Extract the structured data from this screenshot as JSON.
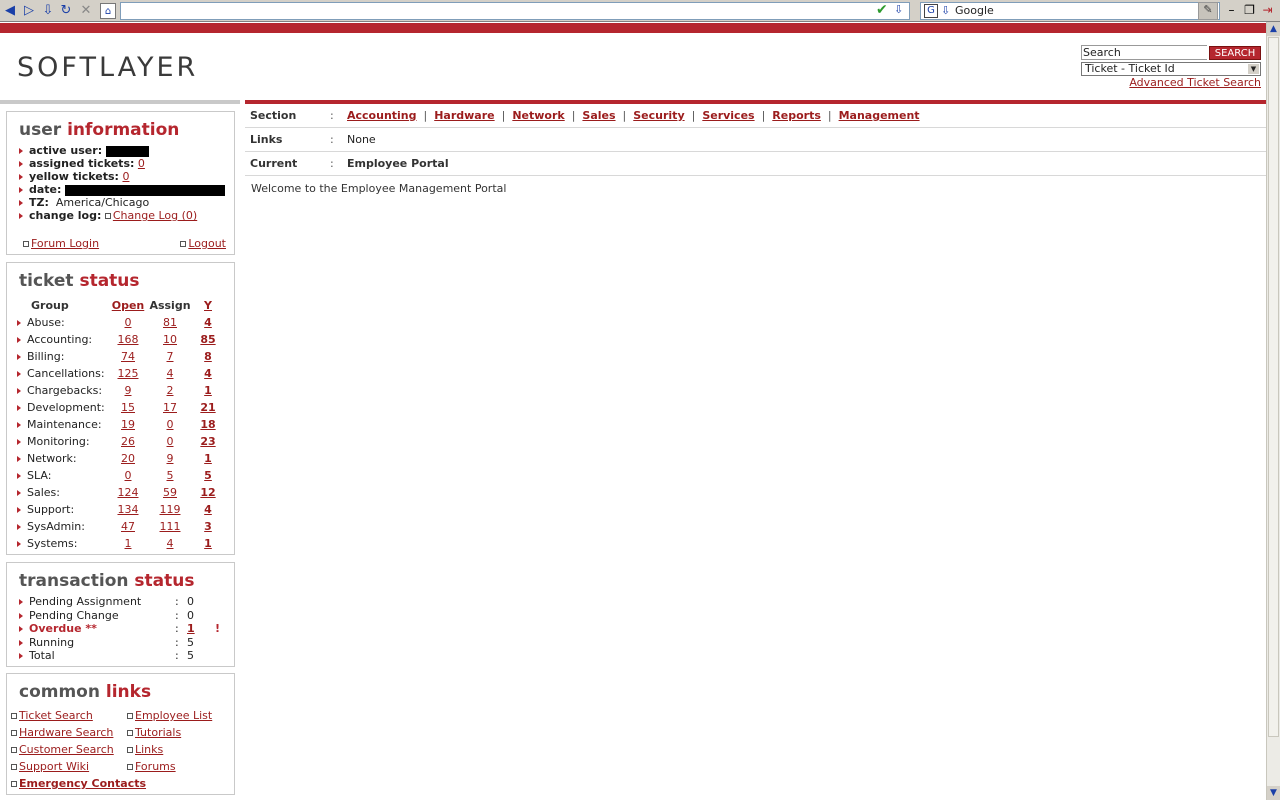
{
  "browser": {
    "search_engine": "Google",
    "buttons": [
      "back-icon",
      "forward-icon",
      "down-icon",
      "reload-icon",
      "stop-icon",
      "home-icon"
    ]
  },
  "header": {
    "logo": "SOFTLAYER",
    "search": {
      "label": "Search",
      "button": "SEARCH",
      "type": "Ticket - Ticket Id",
      "advanced": "Advanced Ticket Search"
    }
  },
  "user_info": {
    "title_a": "user",
    "title_b": "information",
    "active_user_label": "active user:",
    "assigned_label": "assigned tickets:",
    "assigned_value": "0",
    "yellow_label": "yellow tickets:",
    "yellow_value": "0",
    "date_label": "date:",
    "tz_label": "TZ:",
    "tz_value": "America/Chicago",
    "changelog_label": "change log:",
    "changelog_link": "Change Log (0)",
    "forum_login": "Forum Login",
    "logout": "Logout"
  },
  "ticket_status": {
    "title_a": "ticket",
    "title_b": "status",
    "headers": [
      "Group",
      "Open",
      "Assign",
      "Y"
    ],
    "rows": [
      {
        "group": "Abuse:",
        "open": "0",
        "assign": "81",
        "y": "4"
      },
      {
        "group": "Accounting:",
        "open": "168",
        "assign": "10",
        "y": "85"
      },
      {
        "group": "Billing:",
        "open": "74",
        "assign": "7",
        "y": "8"
      },
      {
        "group": "Cancellations:",
        "open": "125",
        "assign": "4",
        "y": "4"
      },
      {
        "group": "Chargebacks:",
        "open": "9",
        "assign": "2",
        "y": "1"
      },
      {
        "group": "Development:",
        "open": "15",
        "assign": "17",
        "y": "21"
      },
      {
        "group": "Maintenance:",
        "open": "19",
        "assign": "0",
        "y": "18"
      },
      {
        "group": "Monitoring:",
        "open": "26",
        "assign": "0",
        "y": "23"
      },
      {
        "group": "Network:",
        "open": "20",
        "assign": "9",
        "y": "1"
      },
      {
        "group": "SLA:",
        "open": "0",
        "assign": "5",
        "y": "5"
      },
      {
        "group": "Sales:",
        "open": "124",
        "assign": "59",
        "y": "12"
      },
      {
        "group": "Support:",
        "open": "134",
        "assign": "119",
        "y": "4"
      },
      {
        "group": "SysAdmin:",
        "open": "47",
        "assign": "111",
        "y": "3"
      },
      {
        "group": "Systems:",
        "open": "1",
        "assign": "4",
        "y": "1"
      }
    ]
  },
  "transaction_status": {
    "title_a": "transaction",
    "title_b": "status",
    "rows": [
      {
        "label": "Pending Assignment",
        "value": "0"
      },
      {
        "label": "Pending Change",
        "value": "0"
      },
      {
        "label": "Overdue **",
        "value": "1",
        "flag": "!"
      },
      {
        "label": "Running",
        "value": "5"
      },
      {
        "label": "Total",
        "value": "5"
      }
    ]
  },
  "common_links": {
    "title_a": "common",
    "title_b": "links",
    "left": [
      "Ticket Search",
      "Hardware Search",
      "Customer Search",
      "Support Wiki",
      "Emergency Contacts"
    ],
    "right": [
      "Employee List",
      "Tutorials",
      "Links",
      "Forums"
    ]
  },
  "main": {
    "section_label": "Section",
    "links_label": "Links",
    "links_value": "None",
    "current_label": "Current",
    "current_value": "Employee Portal",
    "sections": [
      "Accounting",
      "Hardware",
      "Network",
      "Sales",
      "Security",
      "Services",
      "Reports",
      "Management"
    ],
    "welcome": "Welcome to the Employee Management Portal"
  },
  "colors": {
    "brand_red": "#b5262e",
    "link": "#9b1c1c",
    "gray_title": "#555555"
  }
}
